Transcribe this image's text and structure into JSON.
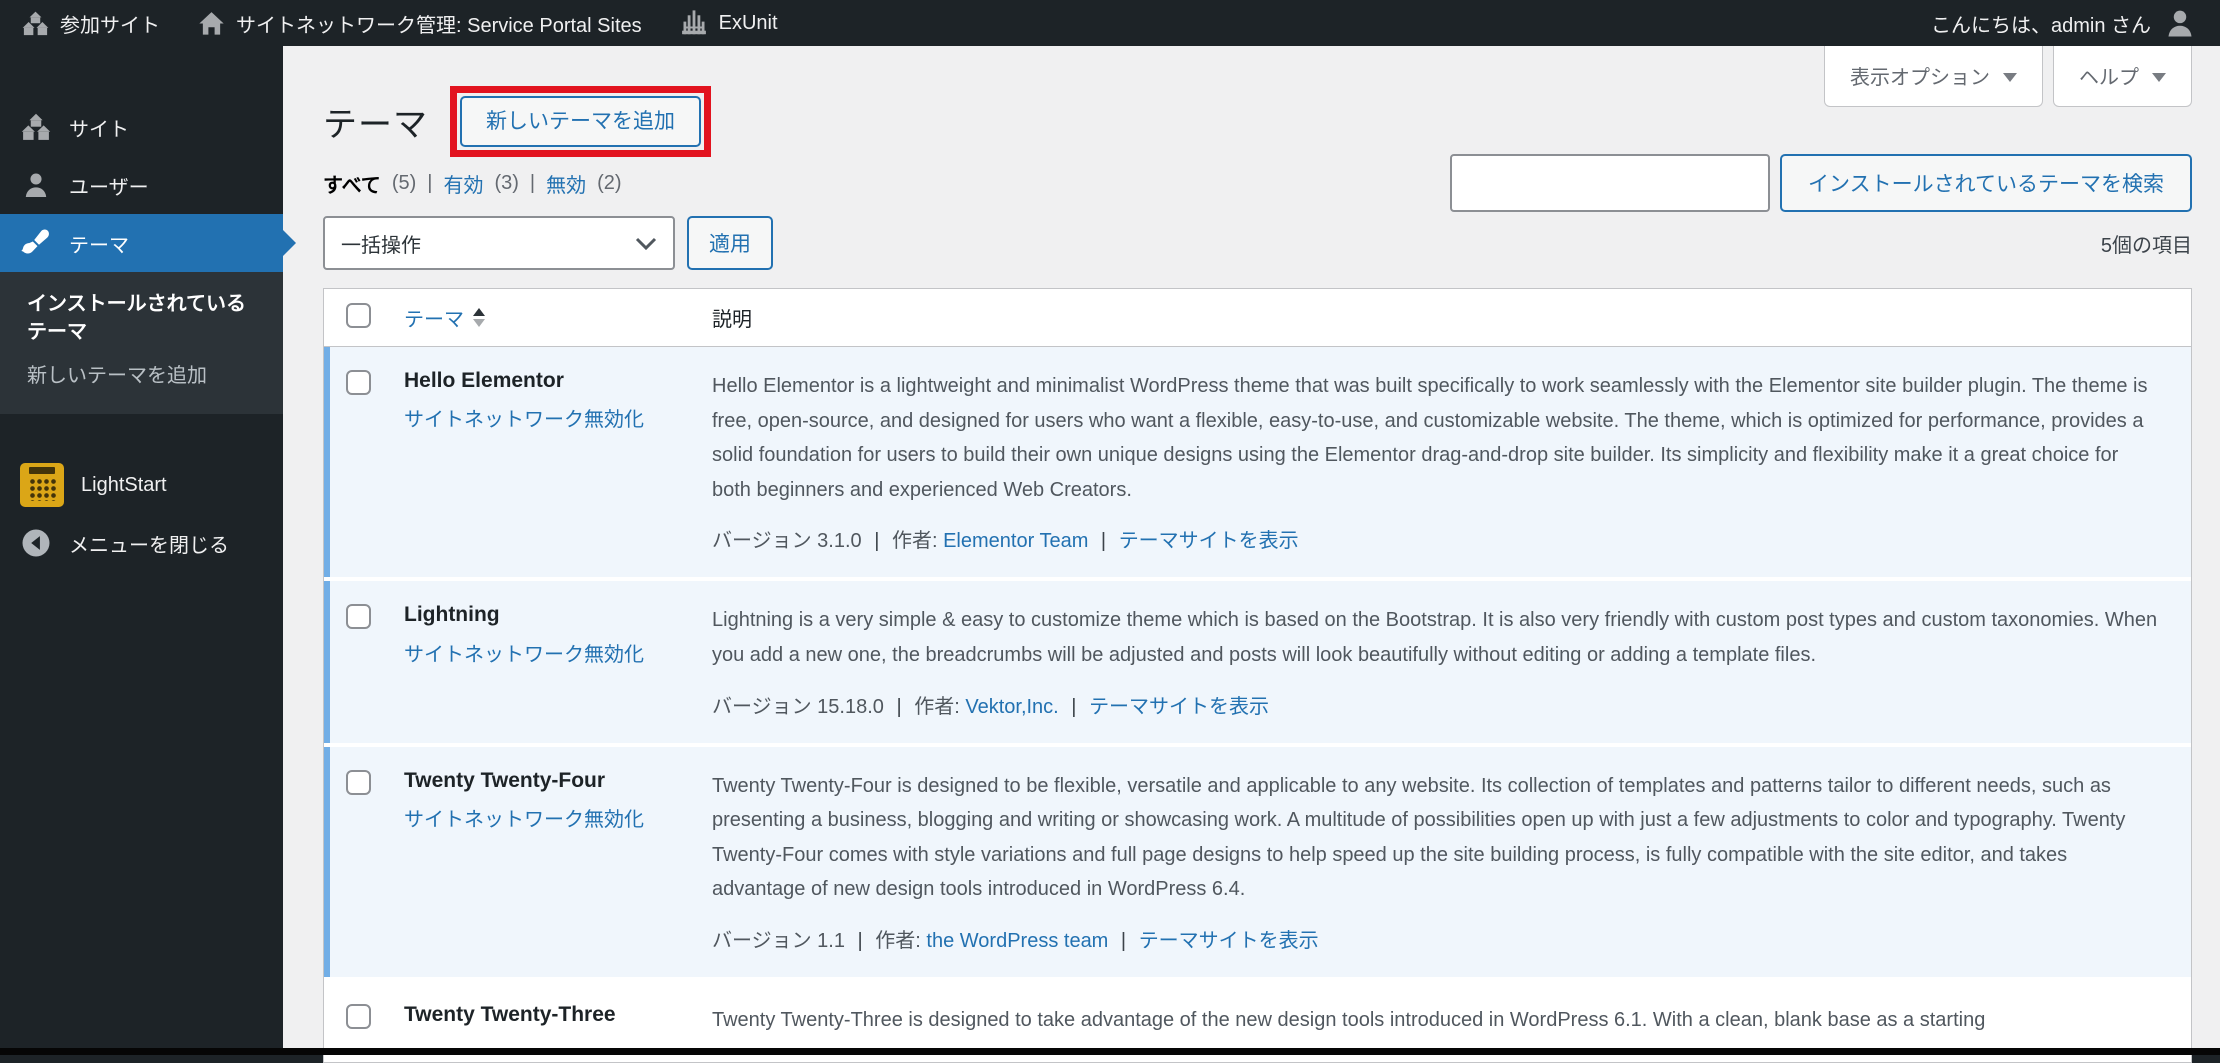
{
  "colors": {
    "accent_blue": "#2271b1",
    "annotation_red": "#e2131f",
    "enabled_row_bg": "#f0f6fc",
    "enabled_row_stripe": "#72aee6",
    "admin_dark": "#1d2327",
    "submenu_dark": "#2c3338",
    "content_bg": "#f0f0f1",
    "lightstart_orange": "#dba617"
  },
  "admin_bar": {
    "items": [
      {
        "label": "参加サイト",
        "icon": "multisite-icon"
      },
      {
        "label": "サイトネットワーク管理: Service Portal Sites",
        "icon": "home-icon"
      },
      {
        "label": "ExUnit",
        "icon": "exunit-icon"
      }
    ],
    "greeting": "こんにちは、admin さん",
    "avatar_icon": "user-avatar-icon"
  },
  "sidebar": {
    "items": [
      {
        "label": "サイト",
        "icon": "sites-icon"
      },
      {
        "label": "ユーザー",
        "icon": "users-icon"
      },
      {
        "label": "テーマ",
        "icon": "appearance-brush-icon",
        "active": true
      }
    ],
    "submenu": [
      {
        "label": "インストールされているテーマ",
        "current": true
      },
      {
        "label": "新しいテーマを追加",
        "current": false
      }
    ],
    "plugin_item": {
      "label": "LightStart",
      "icon": "lightstart-icon"
    },
    "collapse": {
      "label": "メニューを閉じる",
      "icon": "collapse-arrow-icon"
    }
  },
  "screen_meta": {
    "options_label": "表示オプション",
    "help_label": "ヘルプ"
  },
  "page": {
    "title": "テーマ",
    "add_new_label": "新しいテーマを追加",
    "filters": [
      {
        "label": "すべて",
        "count": "(5)",
        "current": true
      },
      {
        "label": "有効",
        "count": "(3)",
        "current": false
      },
      {
        "label": "無効",
        "count": "(2)",
        "current": false
      }
    ],
    "filter_separator": "|",
    "bulk_action_label": "一括操作",
    "apply_label": "適用",
    "search_value": "",
    "search_button_label": "インストールされているテーマを検索",
    "items_count": "5個の項目"
  },
  "table": {
    "columns": {
      "name": "テーマ",
      "description": "説明"
    },
    "meta_separator": "|",
    "rows": [
      {
        "name": "Hello Elementor",
        "action": "サイトネットワーク無効化",
        "enabled": true,
        "description": "Hello Elementor is a lightweight and minimalist WordPress theme that was built specifically to work seamlessly with the Elementor site builder plugin. The theme is free, open-source, and designed for users who want a flexible, easy-to-use, and customizable website. The theme, which is optimized for performance, provides a solid foundation for users to build their own unique designs using the Elementor drag-and-drop site builder. Its simplicity and flexibility make it a great choice for both beginners and experienced Web Creators.",
        "version_label": "バージョン 3.1.0",
        "author_label": "作者:",
        "author": "Elementor Team",
        "theme_site_label": "テーマサイトを表示"
      },
      {
        "name": "Lightning",
        "action": "サイトネットワーク無効化",
        "enabled": true,
        "description": "Lightning is a very simple & easy to customize theme which is based on the Bootstrap. It is also very friendly with custom post types and custom taxonomies. When you add a new one, the breadcrumbs will be adjusted and posts will look beautifully without editing or adding a template files.",
        "version_label": "バージョン 15.18.0",
        "author_label": "作者:",
        "author": "Vektor,Inc.",
        "theme_site_label": "テーマサイトを表示"
      },
      {
        "name": "Twenty Twenty-Four",
        "action": "サイトネットワーク無効化",
        "enabled": true,
        "description": "Twenty Twenty-Four is designed to be flexible, versatile and applicable to any website. Its collection of templates and patterns tailor to different needs, such as presenting a business, blogging and writing or showcasing work. A multitude of possibilities open up with just a few adjustments to color and typography. Twenty Twenty-Four comes with style variations and full page designs to help speed up the site building process, is fully compatible with the site editor, and takes advantage of new design tools introduced in WordPress 6.4.",
        "version_label": "バージョン 1.1",
        "author_label": "作者:",
        "author": "the WordPress team",
        "theme_site_label": "テーマサイトを表示"
      },
      {
        "name": "Twenty Twenty-Three",
        "enabled": false,
        "description": "Twenty Twenty-Three is designed to take advantage of the new design tools introduced in WordPress 6.1. With a clean, blank base as a starting"
      }
    ]
  }
}
